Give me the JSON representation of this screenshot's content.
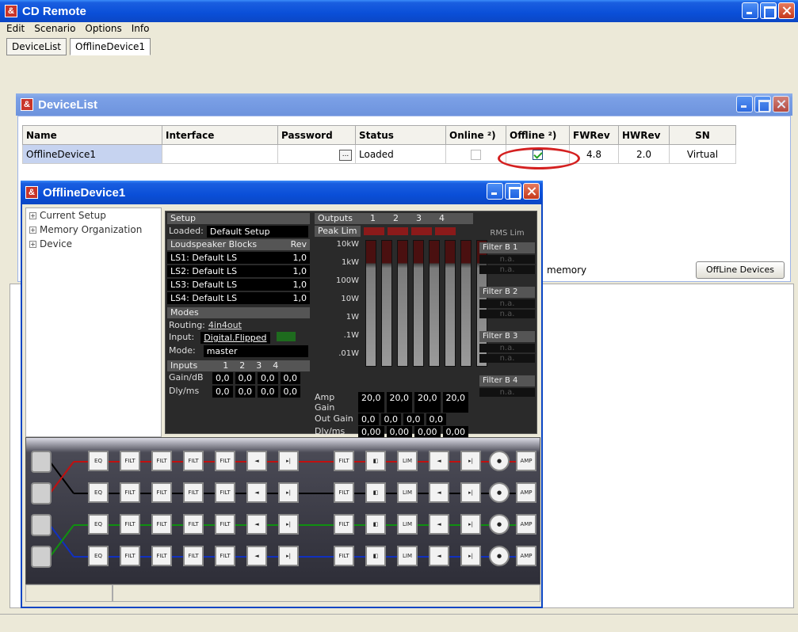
{
  "app": {
    "title": "CD Remote",
    "icon": "&"
  },
  "menu": [
    "Edit",
    "Scenario",
    "Options",
    "Info"
  ],
  "tabs": [
    "DeviceList",
    "OfflineDevice1"
  ],
  "devicelist": {
    "title": "DeviceList",
    "columns": [
      "Name",
      "Interface",
      "Password",
      "Status",
      "Online ²)",
      "Offline ²)",
      "FWRev",
      "HWRev",
      "SN"
    ],
    "row": {
      "name": "OfflineDevice1",
      "interface": "",
      "password_btn": "...",
      "status": "Loaded",
      "fwrev": "4.8",
      "hwrev": "2.0",
      "sn": "Virtual"
    },
    "memory_text": "memory",
    "offline_btn": "OffLine Devices"
  },
  "offline": {
    "title": "OfflineDevice1",
    "tree": [
      "Current Setup",
      "Memory Organization",
      "Device"
    ],
    "setup": {
      "header": "Setup",
      "loaded_label": "Loaded:",
      "loaded_value": "Default Setup",
      "ls_header": "Loudspeaker Blocks",
      "rev_header": "Rev",
      "ls": [
        {
          "label": "LS1:",
          "name": "Default LS",
          "rev": "1,0"
        },
        {
          "label": "LS2:",
          "name": "Default LS",
          "rev": "1,0"
        },
        {
          "label": "LS3:",
          "name": "Default LS",
          "rev": "1,0"
        },
        {
          "label": "LS4:",
          "name": "Default LS",
          "rev": "1,0"
        }
      ],
      "modes_header": "Modes",
      "routing_label": "Routing:",
      "routing_value": "4in4out",
      "input_label": "Input:",
      "input_value": "Digital.Flipped",
      "mode_label": "Mode:",
      "mode_value": "master",
      "inputs_header": "Inputs",
      "channels": [
        "1",
        "2",
        "3",
        "4"
      ],
      "gain_label": "Gain/dB",
      "gains": [
        "0,0",
        "0,0",
        "0,0",
        "0,0"
      ],
      "dly_label": "Dly/ms",
      "dlys": [
        "0,0",
        "0,0",
        "0,0",
        "0,0"
      ]
    },
    "outputs": {
      "header": "Outputs",
      "channels": [
        "1",
        "2",
        "3",
        "4"
      ],
      "peak_lim": "Peak Lim",
      "rms_lim": "RMS Lim",
      "scale": [
        "10kW",
        "1kW",
        "100W",
        "10W",
        "1W",
        ".1W",
        ".01W"
      ],
      "amp_gain_label": "Amp Gain",
      "amp_gains": [
        "20,0",
        "20,0",
        "20,0",
        "20,0"
      ],
      "out_gain_label": "Out Gain",
      "out_gains": [
        "0,0",
        "0,0",
        "0,0",
        "0,0"
      ],
      "dly_label": "Dly/ms",
      "dlys": [
        "0,00",
        "0,00",
        "0,00",
        "0,00"
      ],
      "filters": [
        "Filter B 1",
        "Filter B 2",
        "Filter B 3",
        "Filter B 4"
      ],
      "na": "n.a."
    },
    "chain_labels": {
      "eq": "EQ",
      "filt": "FILT",
      "lim": "LIM",
      "amp": "AMP"
    }
  }
}
